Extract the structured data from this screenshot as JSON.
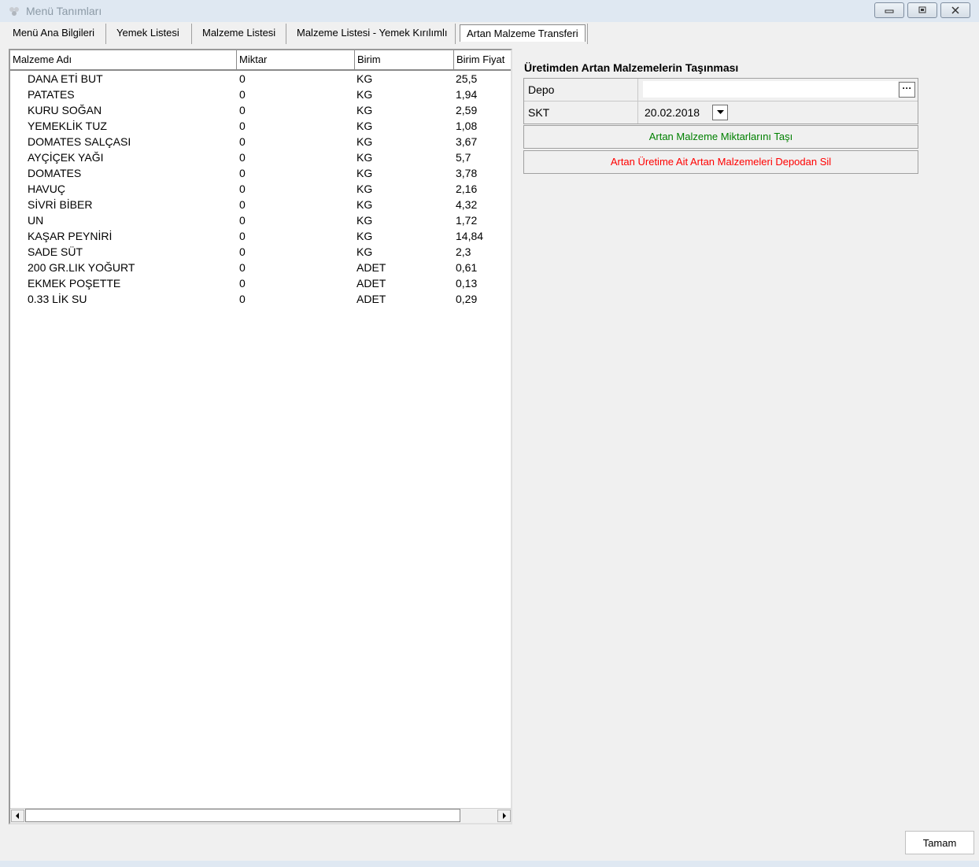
{
  "window": {
    "title": "Menü Tanımları"
  },
  "tabs": [
    {
      "label": "Menü Ana Bilgileri"
    },
    {
      "label": "Yemek Listesi"
    },
    {
      "label": "Malzeme Listesi"
    },
    {
      "label": "Malzeme Listesi - Yemek Kırılımlı"
    },
    {
      "label": "Artan Malzeme Transferi"
    }
  ],
  "grid": {
    "columns": [
      "Malzeme Adı",
      "Miktar",
      "Birim",
      "Birim Fiyat"
    ],
    "rows": [
      [
        "DANA ETİ BUT",
        "0",
        "KG",
        "25,5"
      ],
      [
        "PATATES",
        "0",
        "KG",
        "1,94"
      ],
      [
        "KURU SOĞAN",
        "0",
        "KG",
        "2,59"
      ],
      [
        "YEMEKLİK TUZ",
        "0",
        "KG",
        "1,08"
      ],
      [
        "DOMATES SALÇASI",
        "0",
        "KG",
        "3,67"
      ],
      [
        "AYÇİÇEK YAĞI",
        "0",
        "KG",
        "5,7"
      ],
      [
        "DOMATES",
        "0",
        "KG",
        "3,78"
      ],
      [
        "HAVUÇ",
        "0",
        "KG",
        "2,16"
      ],
      [
        "SİVRİ BİBER",
        "0",
        "KG",
        "4,32"
      ],
      [
        "UN",
        "0",
        "KG",
        "1,72"
      ],
      [
        "KAŞAR PEYNİRİ",
        "0",
        "KG",
        "14,84"
      ],
      [
        "SADE SÜT",
        "0",
        "KG",
        "2,3"
      ],
      [
        "200 GR.LIK YOĞURT",
        "0",
        "ADET",
        "0,61"
      ],
      [
        "EKMEK POŞETTE",
        "0",
        "ADET",
        "0,13"
      ],
      [
        "0.33 LİK SU",
        "0",
        "ADET",
        "0,29"
      ]
    ]
  },
  "transfer": {
    "title": "Üretimden Artan Malzemelerin Taşınması",
    "depo_label": "Depo",
    "depo_value": "",
    "ellipsis": "···",
    "skt_label": "SKT",
    "skt_value": "20.02.2018",
    "move_button": "Artan Malzeme Miktarlarını Taşı",
    "delete_button": "Artan Üretime Ait Artan Malzemeleri Depodan Sil",
    "move_color": "#008000",
    "delete_color": "#ff0000"
  },
  "ok_button": "Tamam"
}
